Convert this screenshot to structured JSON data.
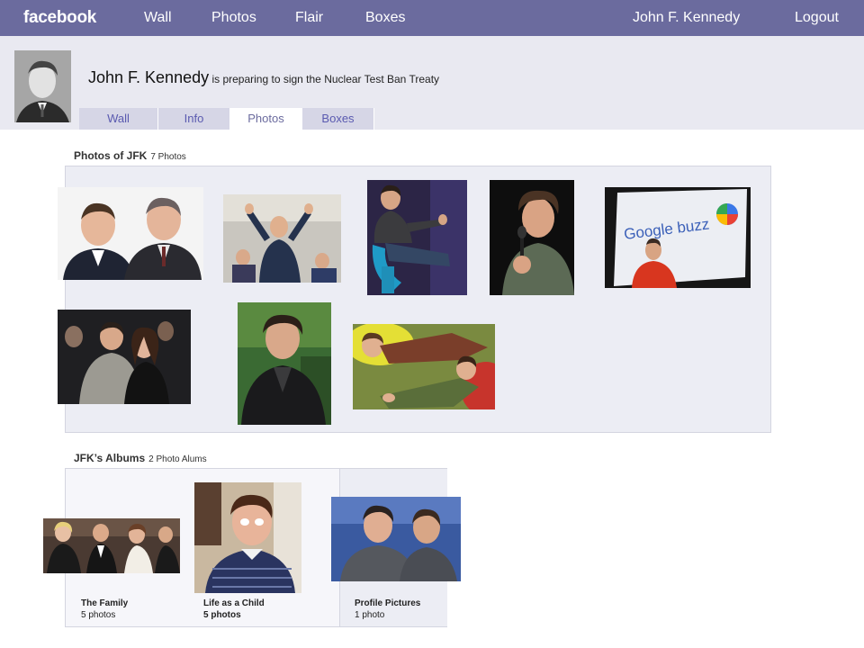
{
  "topbar": {
    "logo": "facebook",
    "nav": [
      "Wall",
      "Photos",
      "Flair",
      "Boxes"
    ],
    "user": "John F. Kennedy",
    "logout": "Logout"
  },
  "profile": {
    "name": "John F. Kennedy",
    "status": "is preparing to sign the Nuclear Test Ban Treaty"
  },
  "tabs": [
    "Wall",
    "Info",
    "Photos",
    "Boxes"
  ],
  "active_tab": "Photos",
  "photos_section": {
    "title": "Photos of JFK",
    "count": "7 Photos"
  },
  "albums_section": {
    "title": "JFK’s Albums",
    "count": "2 Photo Alums",
    "albums": [
      {
        "name": "The Family",
        "count": "5 photos"
      },
      {
        "name": "Life as a Child",
        "count": "5 photos"
      },
      {
        "name": "Profile Pictures",
        "count": "1 photo"
      }
    ]
  },
  "photo_text": {
    "buzz": "Google buzz"
  },
  "colors": {
    "topbar": "#6b6b9e",
    "header_bg": "#e9e9f1",
    "tab_link": "#5a5ab0",
    "panel_bg": "#ecedf4"
  }
}
